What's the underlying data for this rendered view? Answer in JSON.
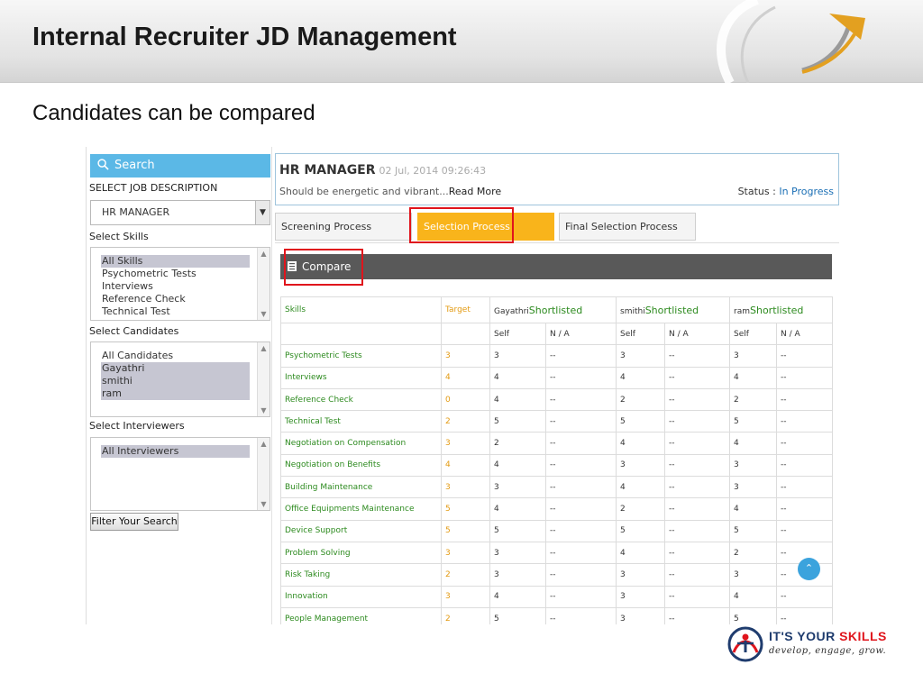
{
  "slide": {
    "title": "Internal Recruiter JD Management",
    "subtitle": "Candidates can be compared"
  },
  "left_panel": {
    "search_label": "Search",
    "job_desc_label": "SELECT JOB DESCRIPTION",
    "job_desc_value": "HR MANAGER",
    "skills_label": "Select Skills",
    "skills_options": [
      {
        "label": "All Skills",
        "selected": true
      },
      {
        "label": "Psychometric Tests",
        "selected": false
      },
      {
        "label": "Interviews",
        "selected": false
      },
      {
        "label": "Reference Check",
        "selected": false
      },
      {
        "label": "Technical Test",
        "selected": false
      }
    ],
    "candidates_label": "Select Candidates",
    "candidates_options": [
      {
        "label": "All Candidates",
        "selected": false
      },
      {
        "label": "Gayathri",
        "selected": true
      },
      {
        "label": "smithi",
        "selected": true
      },
      {
        "label": "ram",
        "selected": true
      }
    ],
    "interviewers_label": "Select Interviewers",
    "interviewers_options": [
      {
        "label": "All Interviewers",
        "selected": true
      }
    ],
    "filter_button": "Filter Your Search"
  },
  "job": {
    "title": "HR MANAGER",
    "date": "02 Jul, 2014 09:26:43",
    "desc": "Should be energetic and vibrant...",
    "read_more": "Read More",
    "status_label": "Status : ",
    "status_value": "In Progress"
  },
  "tabs": [
    {
      "label": "Screening Process",
      "active": false
    },
    {
      "label": "Selection Process",
      "active": true
    },
    {
      "label": "Final Selection Process",
      "active": false
    }
  ],
  "compare_label": "Compare",
  "table": {
    "skills_header": "Skills",
    "target_header": "Target",
    "candidates": [
      {
        "name": "Gayathri",
        "status": "Shortlisted"
      },
      {
        "name": "smithi",
        "status": "Shortlisted"
      },
      {
        "name": "ram",
        "status": "Shortlisted"
      }
    ],
    "sub_headers": [
      "Self",
      "N / A"
    ],
    "rows": [
      {
        "skill": "Psychometric Tests",
        "target": "3",
        "scores": [
          "3",
          "--",
          "3",
          "--",
          "3",
          "--"
        ]
      },
      {
        "skill": "Interviews",
        "target": "4",
        "scores": [
          "4",
          "--",
          "4",
          "--",
          "4",
          "--"
        ]
      },
      {
        "skill": "Reference Check",
        "target": "0",
        "scores": [
          "4",
          "--",
          "2",
          "--",
          "2",
          "--"
        ]
      },
      {
        "skill": "Technical Test",
        "target": "2",
        "scores": [
          "5",
          "--",
          "5",
          "--",
          "5",
          "--"
        ]
      },
      {
        "skill": "Negotiation on Compensation",
        "target": "3",
        "scores": [
          "2",
          "--",
          "4",
          "--",
          "4",
          "--"
        ]
      },
      {
        "skill": "Negotiation on Benefits",
        "target": "4",
        "scores": [
          "4",
          "--",
          "3",
          "--",
          "3",
          "--"
        ]
      },
      {
        "skill": "Building Maintenance",
        "target": "3",
        "scores": [
          "3",
          "--",
          "4",
          "--",
          "3",
          "--"
        ]
      },
      {
        "skill": "Office Equipments Maintenance",
        "target": "5",
        "scores": [
          "4",
          "--",
          "2",
          "--",
          "4",
          "--"
        ]
      },
      {
        "skill": "Device Support",
        "target": "5",
        "scores": [
          "5",
          "--",
          "5",
          "--",
          "5",
          "--"
        ]
      },
      {
        "skill": "Problem Solving",
        "target": "3",
        "scores": [
          "3",
          "--",
          "4",
          "--",
          "2",
          "--"
        ]
      },
      {
        "skill": "Risk Taking",
        "target": "2",
        "scores": [
          "3",
          "--",
          "3",
          "--",
          "3",
          "--"
        ]
      },
      {
        "skill": "Innovation",
        "target": "3",
        "scores": [
          "4",
          "--",
          "3",
          "--",
          "4",
          "--"
        ]
      },
      {
        "skill": "People Management",
        "target": "2",
        "scores": [
          "5",
          "--",
          "3",
          "--",
          "5",
          "--"
        ]
      }
    ]
  },
  "logo": {
    "brand_prefix": "IT'S YOUR ",
    "brand_suffix": "SKILLS",
    "tagline": "develop, engage, grow."
  },
  "colors": {
    "accent_orange": "#f9b41b",
    "search_blue": "#5bb8e6",
    "highlight_red": "#e0141c",
    "skill_green": "#2c8a1e"
  }
}
